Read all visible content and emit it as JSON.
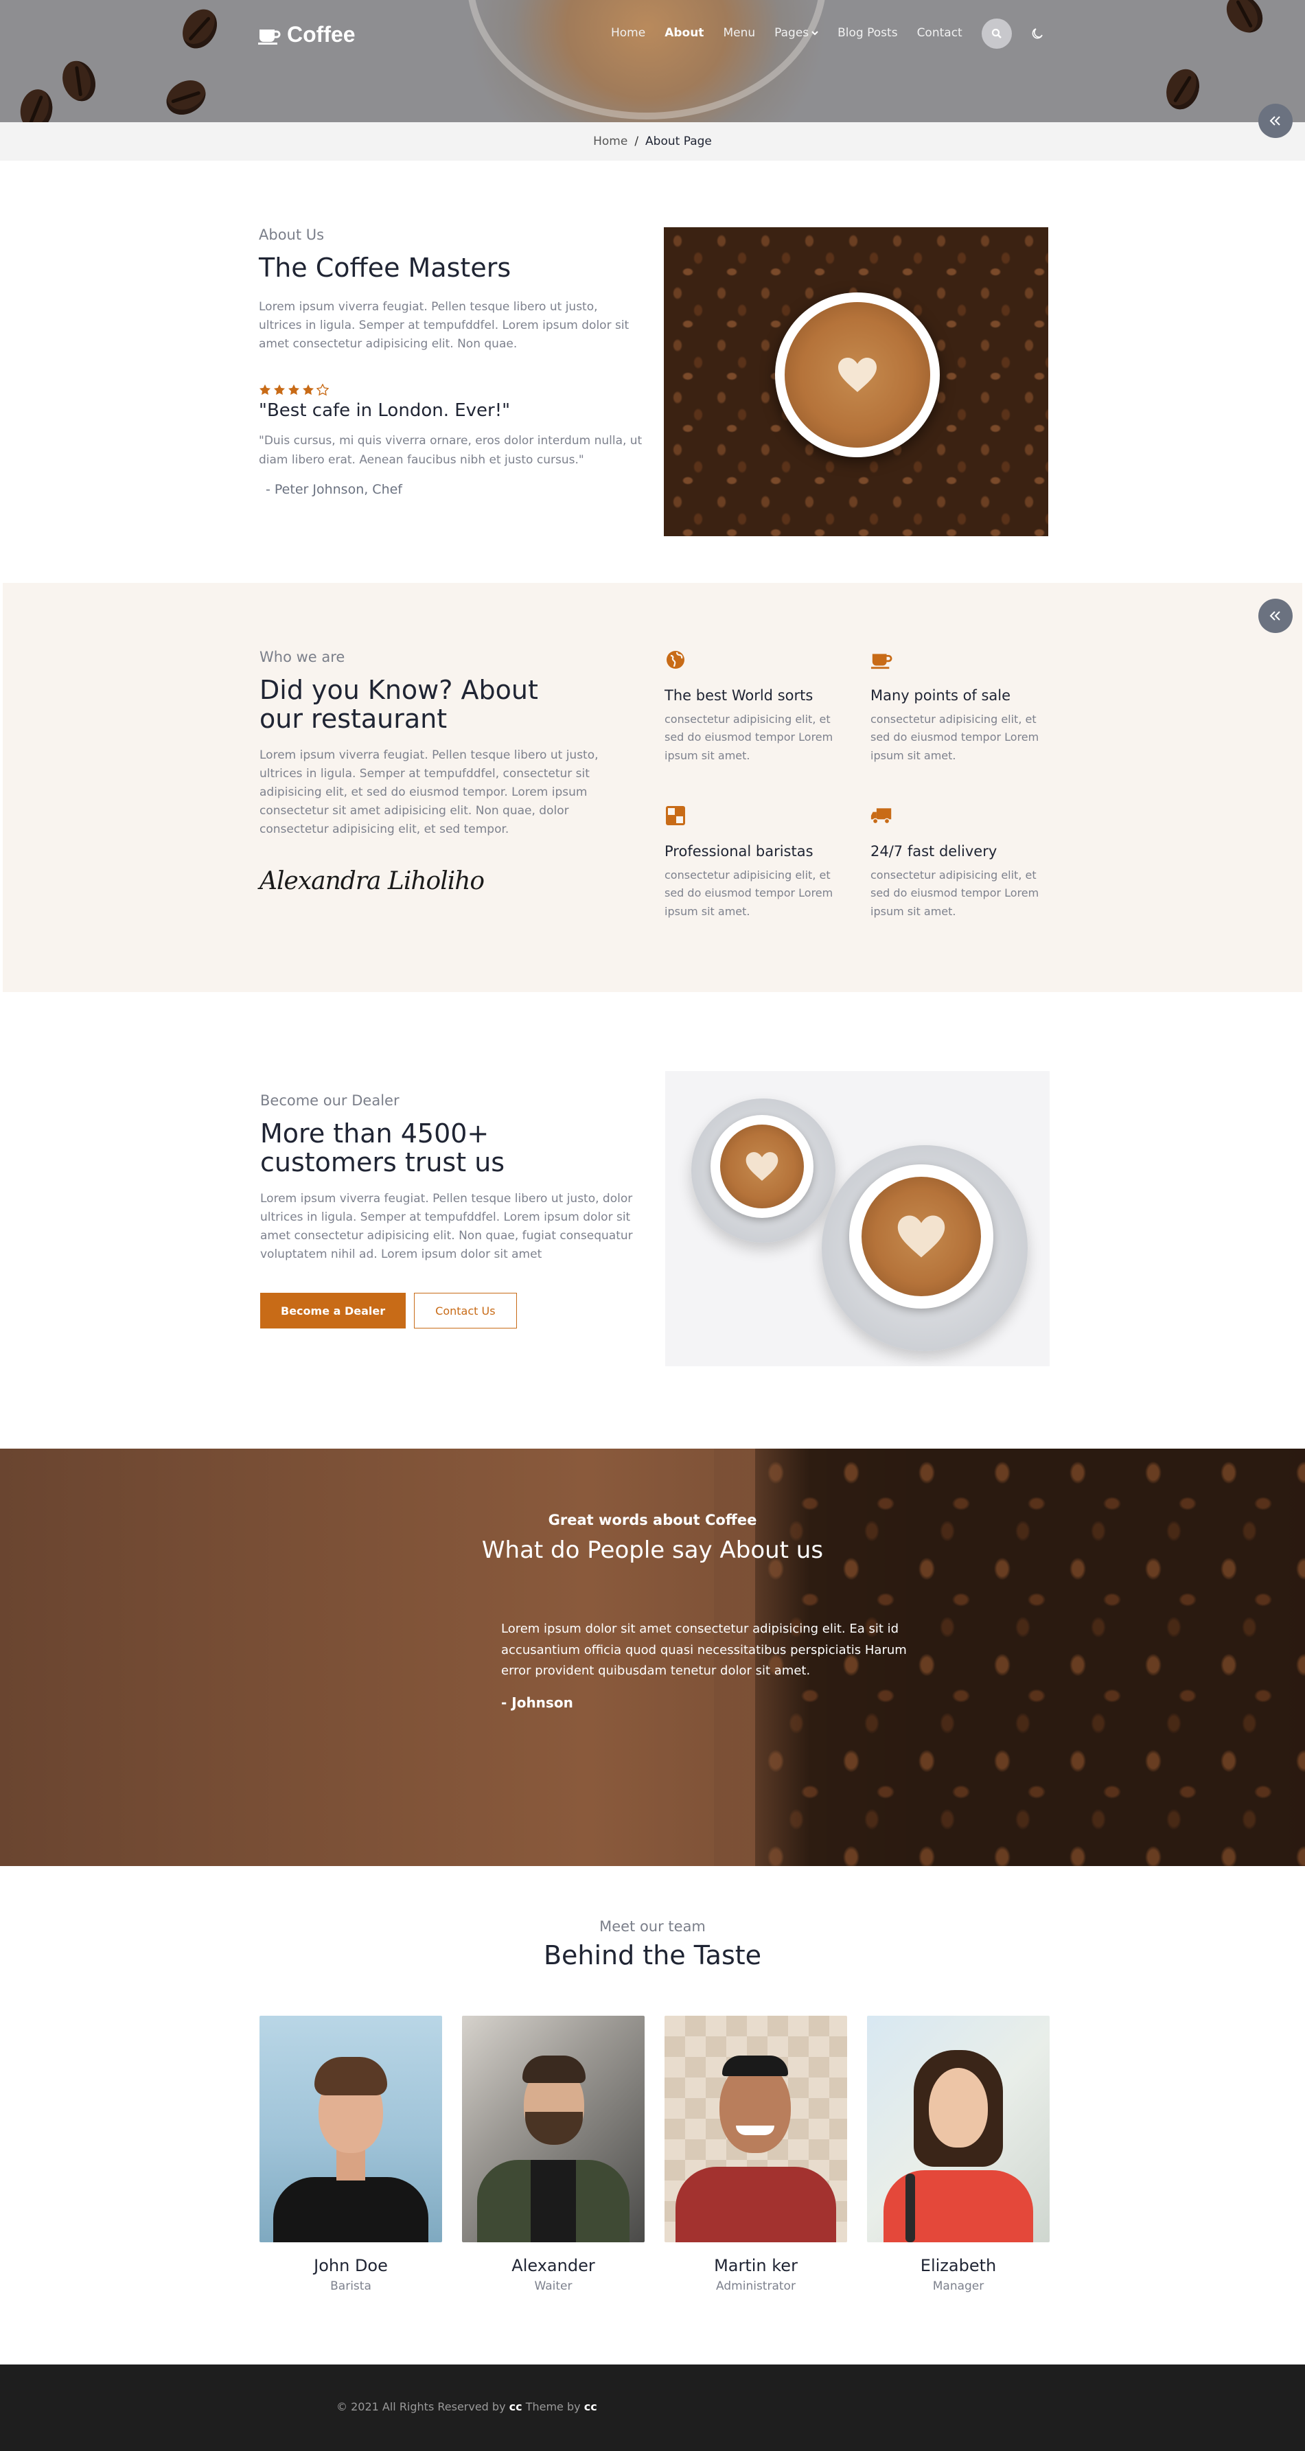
{
  "header": {
    "logo_text": "Coffee",
    "nav": [
      {
        "label": "Home"
      },
      {
        "label": "About",
        "active": true
      },
      {
        "label": "Menu"
      },
      {
        "label": "Pages",
        "dropdown": true
      },
      {
        "label": "Blog Posts"
      },
      {
        "label": "Contact"
      }
    ],
    "icons": [
      "coffee-cup-icon",
      "search-icon",
      "moon-icon",
      "double-chevron-left-icon"
    ]
  },
  "breadcrumb": {
    "home": "Home",
    "separator": "/",
    "current": "About Page"
  },
  "about": {
    "subtitle": "About Us",
    "title": "The Coffee Masters",
    "text": "Lorem ipsum viverra feugiat. Pellen tesque libero ut justo, ultrices in ligula. Semper at tempufddfel. Lorem ipsum dolor sit amet consectetur adipisicing elit. Non quae.",
    "rating": 4,
    "rating_max": 5,
    "quote": "\"Best cafe in London. Ever!\"",
    "quote_text": "\"Duis cursus, mi quis viverra ornare, eros dolor interdum nulla, ut diam libero erat. Aenean faucibus nibh et justo cursus.\"",
    "author": "- Peter Johnson, Chef"
  },
  "who": {
    "subtitle": "Who we are",
    "title": "Did you Know? About our restaurant",
    "text": "Lorem ipsum viverra feugiat. Pellen tesque libero ut justo, ultrices in ligula. Semper at tempufddfel, consectetur sit adipisicing elit, et sed do eiusmod tempor. Lorem ipsum consectetur sit amet adipisicing elit. Non quae, dolor consectetur adipisicing elit, et sed tempor.",
    "signature": "Alexandra Liholiho",
    "features": [
      {
        "icon": "globe-icon",
        "title": "The best World sorts",
        "text": "consectetur adipisicing elit, et sed do eiusmod tempor Lorem ipsum sit amet."
      },
      {
        "icon": "coffee-cup-icon",
        "title": "Many points of sale",
        "text": "consectetur adipisicing elit, et sed do eiusmod tempor Lorem ipsum sit amet."
      },
      {
        "icon": "barista-icon",
        "title": "Professional baristas",
        "text": "consectetur adipisicing elit, et sed do eiusmod tempor Lorem ipsum sit amet."
      },
      {
        "icon": "truck-icon",
        "title": "24/7 fast delivery",
        "text": "consectetur adipisicing elit, et sed do eiusmod tempor Lorem ipsum sit amet."
      }
    ]
  },
  "dealer": {
    "subtitle": "Become our Dealer",
    "title": "More than 4500+ customers trust us",
    "text": "Lorem ipsum viverra feugiat. Pellen tesque libero ut justo, dolor ultrices in ligula. Semper at tempufddfel. Lorem ipsum dolor sit amet consectetur adipisicing elit. Non quae, fugiat consequatur voluptatem nihil ad. Lorem ipsum dolor sit amet",
    "primary_button": "Become a Dealer",
    "secondary_button": "Contact Us"
  },
  "testimonial": {
    "subtitle": "Great words about Coffee",
    "title": "What do People say About us",
    "text": "Lorem ipsum dolor sit amet consectetur adipisicing elit. Ea sit id accusantium officia quod quasi necessitatibus perspiciatis Harum error provident quibusdam tenetur dolor sit amet.",
    "author": "- Johnson"
  },
  "team": {
    "subtitle": "Meet our team",
    "title": "Behind the Taste",
    "members": [
      {
        "name": "John Doe",
        "role": "Barista"
      },
      {
        "name": "Alexander",
        "role": "Waiter"
      },
      {
        "name": "Martin ker",
        "role": "Administrator"
      },
      {
        "name": "Elizabeth",
        "role": "Manager"
      }
    ]
  },
  "footer": {
    "prefix": "© 2021 All Rights Reserved by",
    "brand1": "cc",
    "middle": "Theme by",
    "brand2": "cc"
  },
  "colors": {
    "accent": "#c86b17",
    "dark": "#1f2433",
    "muted": "#7d818d",
    "cream": "#f9f4ef",
    "footer": "#1e1e1e"
  }
}
